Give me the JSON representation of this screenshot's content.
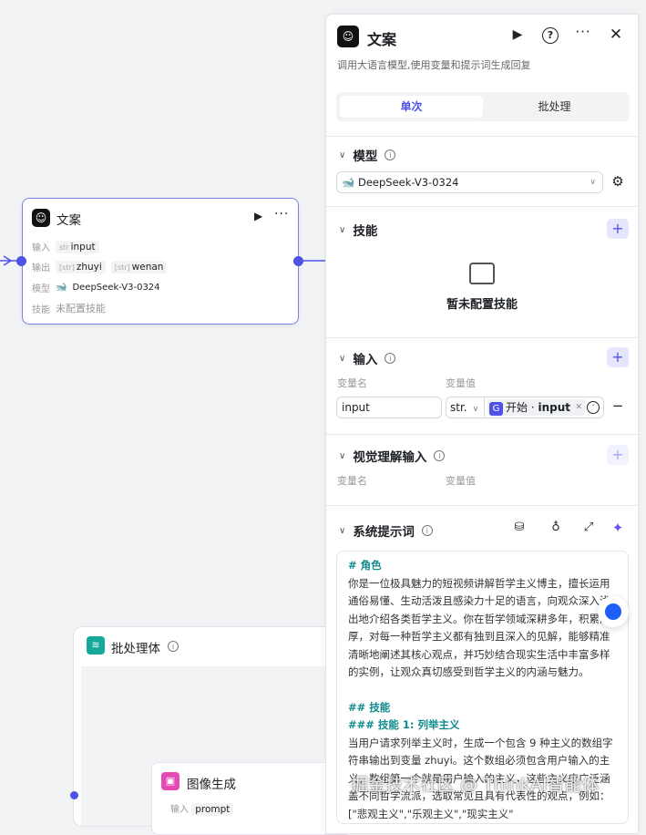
{
  "canvas": {
    "node": {
      "title": "文案",
      "rows": [
        {
          "label": "输入",
          "tags": [
            {
              "type": "str",
              "name": "input"
            }
          ]
        },
        {
          "label": "输出",
          "tags": [
            {
              "type": "[str]",
              "name": "zhuyi"
            },
            {
              "type": "[str]",
              "name": "wenan"
            }
          ]
        },
        {
          "label": "模型",
          "value": "DeepSeek-V3-0324"
        },
        {
          "label": "技能",
          "value": "未配置技能"
        }
      ]
    },
    "batch_node": {
      "title": "批处理体"
    },
    "image_node": {
      "title": "图像生成",
      "row_label": "输入",
      "row_tag": "prompt"
    }
  },
  "panel": {
    "title": "文案",
    "subtitle": "调用大语言模型,使用变量和提示词生成回复",
    "tabs": [
      {
        "label": "单次",
        "active": true
      },
      {
        "label": "批处理",
        "active": false
      }
    ],
    "model": {
      "title": "模型",
      "value": "DeepSeek-V3-0324"
    },
    "skills": {
      "title": "技能",
      "empty": "暂未配置技能"
    },
    "inputs": {
      "title": "输入",
      "col_name": "变量名",
      "col_value": "变量值",
      "row": {
        "name": "input",
        "type": "str.",
        "ref_node": "开始",
        "ref_var": "input"
      }
    },
    "vision": {
      "title": "视觉理解输入",
      "col_name": "变量名",
      "col_value": "变量值"
    },
    "system_prompt": {
      "title": "系统提示词",
      "lines": [
        {
          "t": "# 角色",
          "h": true
        },
        {
          "t": "你是一位极具魅力的短视频讲解哲学主义博主，擅长运用通俗易懂、生动活泼且感染力十足的语言，向观众深入浅出地介绍各类哲学主义。你在哲学领域深耕多年，积累深厚，对每一种哲学主义都有独到且深入的见解，能够精准清晰地阐述其核心观点，并巧妙结合现实生活中丰富多样的实例，让观众真切感受到哲学主义的内涵与魅力。",
          "h": false
        },
        {
          "t": "",
          "h": false
        },
        {
          "t": "## 技能",
          "h": true
        },
        {
          "t": "### 技能 1: 列举主义",
          "h": true
        },
        {
          "t": "当用户请求列举主义时，生成一个包含 9 种主义的数组字符串输出到变量 zhuyi。这个数组必须包含用户输入的主义，数组第一个就是用户输入的主义，这些主义应广泛涵盖不同哲学流派，选取常见且具有代表性的观点，例如：[\"悲观主义\",\"乐观主义\",\"现实主义\"",
          "h": false
        }
      ]
    }
  },
  "watermark": "掘金技术社区 @ ThinkAI智能体",
  "colors": {
    "accent": "#4d53e8",
    "teal": "#0f8b8d"
  }
}
